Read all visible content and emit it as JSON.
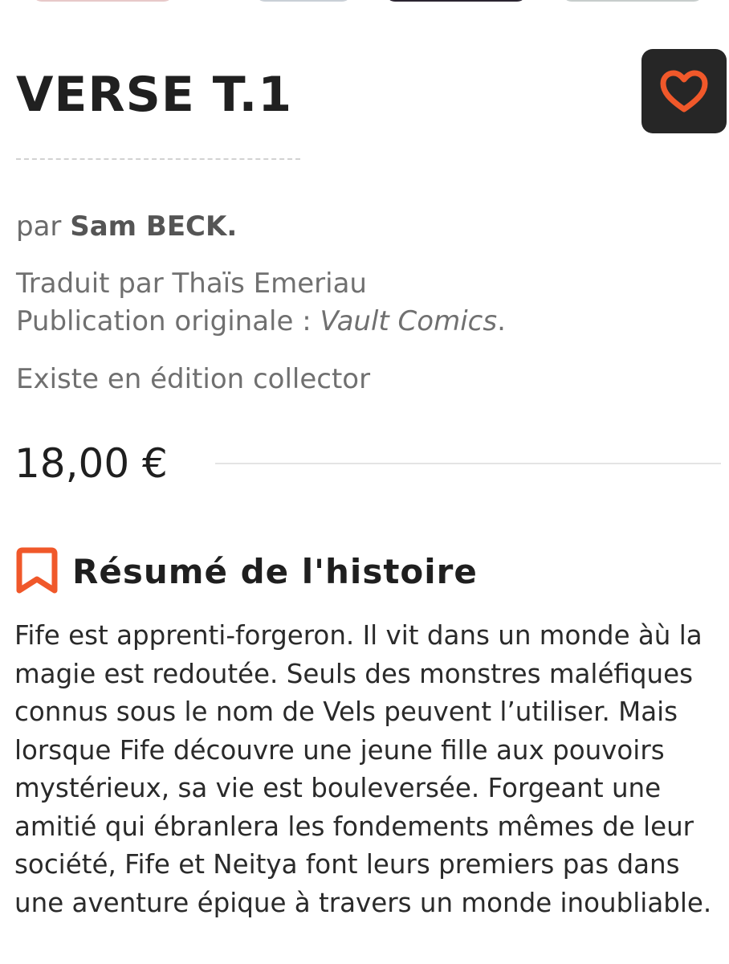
{
  "book": {
    "title": "VERSE T.1",
    "byline_prefix": "par",
    "author": "Sam BECK.",
    "translator_line": "Traduit par Thaïs Emeriau",
    "original_pub_label": "Publication originale :",
    "original_publisher": "Vault Comics",
    "original_pub_suffix": ".",
    "collector_note": "Existe en édition collector",
    "price": "18,00 €"
  },
  "favorite": {
    "icon": "heart-icon",
    "accent_color": "#f0582a",
    "button_color": "#262626"
  },
  "summary": {
    "icon": "bookmark-icon",
    "heading": "Résumé de l'histoire",
    "text": "Fife est apprenti-forgeron. Il vit dans un monde àù la magie est redoutée. Seuls des monstres maléfiques connus sous le nom de Vels peuvent l’utiliser. Mais lorsque Fife découvre une jeune fille aux pouvoirs mystérieux, sa vie est bouleversée. Forgeant une amitié qui ébranlera les fondements mêmes de leur société, Fife et Neitya font leurs premiers pas dans une aventure épique à travers un monde inoubliable."
  }
}
